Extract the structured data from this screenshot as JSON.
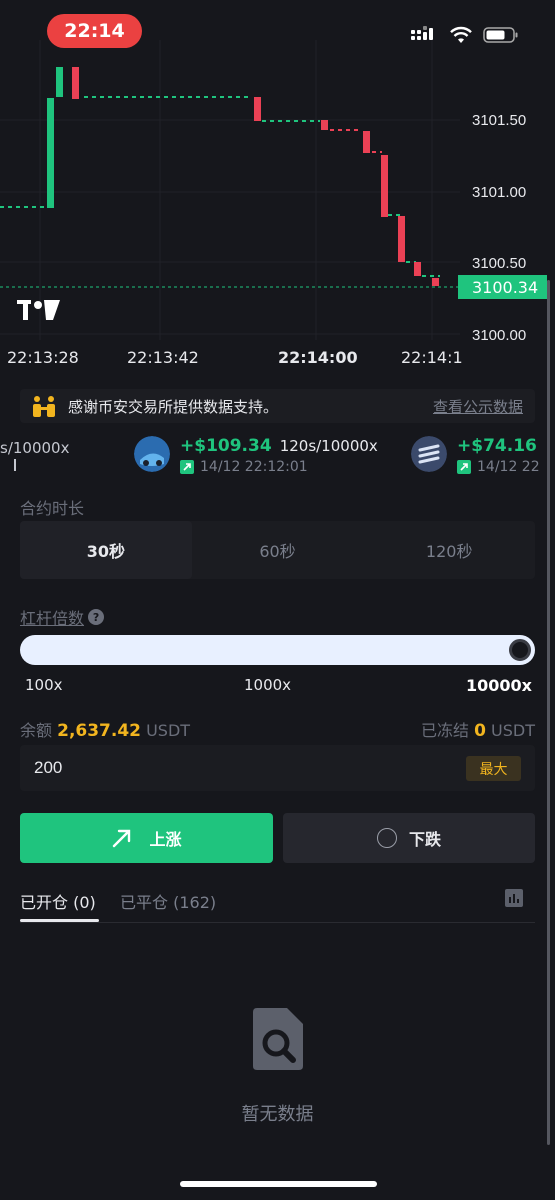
{
  "status_bar": {
    "time": "22:14"
  },
  "chart": {
    "price_ticks": [
      "3101.50",
      "3101.00",
      "3100.50",
      "3100.00"
    ],
    "current_price": "3100.34",
    "time_ticks": [
      "22:13:28",
      "22:13:42",
      "22:14:00",
      "22:14:1"
    ],
    "colors": {
      "up": "#1fc47e",
      "down": "#eb4155"
    }
  },
  "notice": {
    "text": "感谢币安交易所提供数据支持。",
    "link": "查看公示数据"
  },
  "ticker": {
    "leading_fragment": "s/10000x",
    "items": [
      {
        "profit": "+$109.34",
        "meta": "120s/10000x",
        "date": "14/12 22:12:01"
      },
      {
        "profit": "+$74.16",
        "meta": "",
        "date": "14/12 22"
      }
    ]
  },
  "duration": {
    "label": "合约时长",
    "options": [
      "30秒",
      "60秒",
      "120秒"
    ],
    "selected": "30秒"
  },
  "leverage": {
    "label": "杠杆倍数",
    "marks": [
      "100x",
      "1000x",
      "10000x"
    ],
    "level": 1.0
  },
  "balance": {
    "label": "余额",
    "value": "2,637.42",
    "unit": "USDT",
    "frozen_label": "已冻结",
    "frozen_value": "0",
    "frozen_unit": "USDT"
  },
  "amount_input": {
    "value": "200",
    "max_label": "最大"
  },
  "actions": {
    "up_label": "上涨",
    "down_label": "下跌"
  },
  "positions": {
    "open_tab": "已开仓 (0)",
    "closed_tab": "已平仓 (162)",
    "empty_text": "暂无数据"
  }
}
